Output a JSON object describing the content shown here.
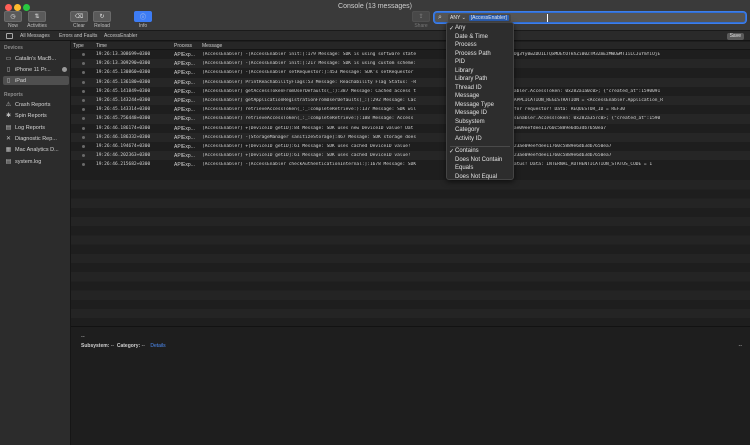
{
  "window": {
    "title": "Console (13 messages)"
  },
  "toolbar": {
    "now": "Now",
    "activities": "Activities",
    "clear": "Clear",
    "reload": "Reload",
    "info": "Info",
    "share": "Share"
  },
  "search": {
    "token_key": "ANY ⌄",
    "token_value": "[AccessEnabler]"
  },
  "filterbar": {
    "all": "All Messages",
    "errors": "Errors and Faults",
    "saved": "AccessEnabler",
    "save": "Save"
  },
  "sidebar": {
    "devices_header": "Devices",
    "devices": [
      {
        "label": "Catalin's MacB...",
        "icon": "laptop-icon"
      },
      {
        "label": "iPhone 11 Pr...",
        "icon": "phone-icon"
      },
      {
        "label": "iPad",
        "icon": "tablet-icon"
      }
    ],
    "reports_header": "Reports",
    "reports": [
      {
        "label": "Crash Reports",
        "icon": "warning-icon"
      },
      {
        "label": "Spin Reports",
        "icon": "spinner-icon"
      },
      {
        "label": "Log Reports",
        "icon": "document-icon"
      },
      {
        "label": "Diagnostic Rep...",
        "icon": "tools-icon"
      },
      {
        "label": "Mac Analytics D...",
        "icon": "grid-icon"
      },
      {
        "label": "system.log",
        "icon": "document-icon"
      }
    ]
  },
  "columns": {
    "type": "Type",
    "time": "Time",
    "process": "Process",
    "message": "Message"
  },
  "rows": [
    {
      "time": "19:26:13.308699+0300",
      "process": "APIExp...",
      "message": "[AccessEnabler] -[AccessEnabler init:]:179  Message: SDK is using software state"
    },
    {
      "time": "19:26:13.309290+0300",
      "process": "APIExp...",
      "message": "[AccessEnabler] -[AccessEnabler init:]:217  Message: SDK is using custom scheme:"
    },
    {
      "time": "19:26:45.130860+0300",
      "process": "APIExp...",
      "message": "[AccessEnabler] -[AccessEnabler setRequestor:]:453  Message: SDK's setRequestor"
    },
    {
      "time": "19:26:45.136180+0300",
      "process": "APIExp...",
      "message": "[AccessEnabler] PrintReachabilityFlags:53  Message: Reachability Flag Status: -R"
    },
    {
      "time": "19:26:45.141849+0300",
      "process": "APIExp...",
      "message": "[AccessEnabler] getAccessTokenFromUserDefaults(_:):387  Message: Cached access t"
    },
    {
      "time": "19:26:45.143244+0300",
      "process": "APIExp...",
      "message": "[AccessEnabler] getApplicationRegistrationFromUserDefaults(_:):292  Message: Cac"
    },
    {
      "time": "19:26:45.143314+0300",
      "process": "APIExp...",
      "message": "[AccessEnabler] retrieveAccessToken(_:_:completeRetrieve:):137  Message: SDK wil"
    },
    {
      "time": "19:26:45.756448+0300",
      "process": "APIExp...",
      "message": "[AccessEnabler] retrieveAccessToken(_:_:completeRetrieve:):188  Message: Access"
    },
    {
      "time": "19:26:46.186174+0300",
      "process": "APIExp...",
      "message": "[AccessEnabler] +[DeviceID getID]:84  Message: SDK uses new DeviceID value!  Dat"
    },
    {
      "time": "19:26:46.186332+0300",
      "process": "APIExp...",
      "message": "[AccessEnabler] -[StorageManager sanitizeStorage]:467  Message: SDK storage does"
    },
    {
      "time": "19:26:46.194674+0300",
      "process": "APIExp...",
      "message": "[AccessEnabler] +[DeviceID getID]:61  Message: SDK uses cached DeviceID value!"
    },
    {
      "time": "19:26:46.202363+0300",
      "process": "APIExp...",
      "message": "[AccessEnabler] +[DeviceID getID]:61  Message: SDK uses cached DeviceID value!"
    },
    {
      "time": "19:26:46.215682+0300",
      "process": "APIExp...",
      "message": "[AccessEnabler] -[AccessEnabler checkAuthenticationInternal:]:1678  Message: SDK"
    }
  ],
  "row_tails": [
    "1J9.eyJzdWIiOiI1MDFhODg3Yy0wZDU1LTQxMDEtOTkhZi00ZTM3ZmEzMWUwMTIiLCJuYmYiOjE",
    "://adobe.com!",
    "ARGUMENTS = REF30",
    "rFlags",
    "ESS_TOKEN = <AccessEnabler.AccessToken: 0x282a1a0c0>; {\"created_at\":1590091",
    "tration found!  Data: APPLICATION_REGISTRATION = <AccessEnabler.Application_R",
    "ss token from server for requestor!  Data: REQUESTOR_ID = REF30",
    "ACCESS_TOKEN = <AccessEnabler.AccessToken: 0x282a357c0>; {\"created_at\":1590",
    "fb55accbb1d84be00ac23ae09eefdee11760c5889e6db3db7650ea7",
    "",
    "d4fb55accbb1d84be00ac23ae09eefdee11760c5889e6db3db7650ea7",
    "d4fb55accbb1d84be00ac23ae09eefdee11760c5889e6db3db7650ea7",
    "nal authentication status!  Data: INTERNAL_AUTHENTICATION_STATUS_CODE = 1"
  ],
  "detail": {
    "dash": "--",
    "subsystem_label": "Subsystem:",
    "subsystem_value": "--",
    "category_label": "Category:",
    "category_value": "--",
    "details_link": "Details",
    "right_dash": "--"
  },
  "dropdown": {
    "fields": [
      "Any",
      "Date & Time",
      "Process",
      "Process Path",
      "PID",
      "Library",
      "Library Path",
      "Thread ID",
      "Message",
      "Message Type",
      "Message ID",
      "Subsystem",
      "Category",
      "Activity ID"
    ],
    "operators": [
      "Contains",
      "Does Not Contain",
      "Equals",
      "Does Not Equal"
    ],
    "selected_field": "Any",
    "selected_operator": "Contains"
  }
}
